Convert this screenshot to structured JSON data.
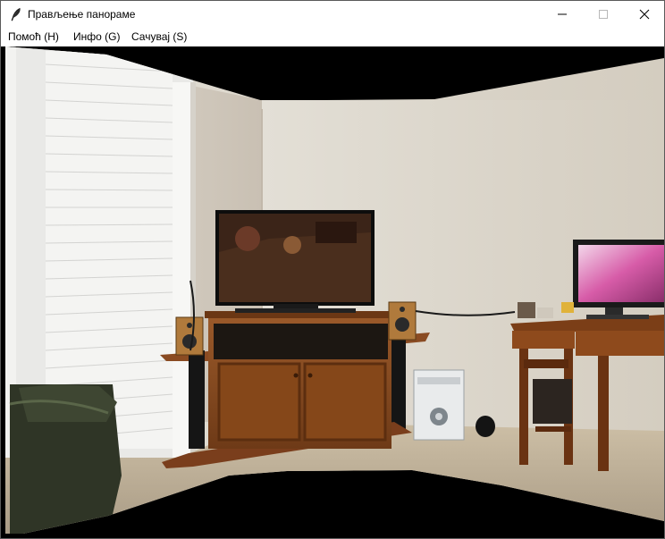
{
  "window": {
    "title": "Прављење панораме",
    "controls": {
      "minimize_icon": "minimize-icon",
      "maximize_icon": "maximize-icon",
      "close_icon": "close-icon"
    }
  },
  "menu": {
    "items": [
      {
        "label": "Помоћ (H)"
      },
      {
        "label": "Инфо (G)"
      },
      {
        "label": "Сачувај (S)"
      }
    ]
  },
  "canvas": {
    "content": "stitched-panorama-photo",
    "background": "#000000"
  },
  "icons": {
    "app": "feather-icon"
  }
}
